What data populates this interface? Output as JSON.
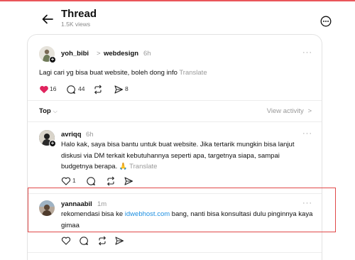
{
  "header": {
    "title": "Thread",
    "views": "1.5K views"
  },
  "main_post": {
    "username": "yoh_bibi",
    "separator": ">",
    "community": "webdesign",
    "time": "6h",
    "text": "Lagi cari yg bisa buat website, boleh dong info",
    "translate": "Translate",
    "likes": "16",
    "comments": "44",
    "shares": "8",
    "liked": true,
    "like_color": "#e0245e"
  },
  "sort_bar": {
    "sort_label": "Top",
    "view_activity": "View activity",
    "chevron_right": ">"
  },
  "replies": [
    {
      "username": "avriqq",
      "time": "6h",
      "text": "Halo kak, saya bisa bantu untuk buat website. Jika tertarik mungkin bisa lanjut diskusi via DM terkait kebutuhannya seperti apa, targetnya siapa, sampai budgetnya berapa. 🙏",
      "translate": "Translate",
      "likes": "1"
    },
    {
      "username": "yannaabil",
      "time": "1m",
      "text_before": "rekomendasi bisa ke ",
      "link": "idwebhost.com",
      "text_after": " bang, nanti bisa konsultasi dulu pinginnya kaya gimaa"
    }
  ],
  "colors": {
    "highlight_border": "#e04848",
    "link": "#1d8fe1"
  }
}
